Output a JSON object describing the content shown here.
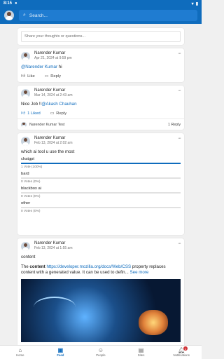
{
  "status": {
    "time": "8:15",
    "icons": [
      "wifi-icon",
      "battery-icon"
    ]
  },
  "header": {
    "search_label": "Search..."
  },
  "compose": {
    "placeholder": "Share your thoughts or questions..."
  },
  "posts": [
    {
      "author": "Narender Kumar",
      "date": "Apr 21, 2024 at 9:59 pm",
      "body_mention": "@Narender Kumar",
      "body_suffix": " hi",
      "like_label": "Like",
      "reply_label": "Reply"
    },
    {
      "author": "Narender Kumar",
      "date": "Mar 14, 2024 at 2:43 am",
      "body_prefix": "Nice Job !!",
      "body_mention": "@Akash Chauhan",
      "like_label": "Liked",
      "like_count": "1",
      "reply_label": "Reply",
      "reply_preview_author": "Narender Kumar",
      "reply_preview_text": "Test",
      "reply_count_label": "1 Reply"
    },
    {
      "author": "Narender Kumar",
      "date": "Feb 13, 2024 at 2:02 am",
      "question": "which ai tool u use the most",
      "poll": [
        {
          "label": "chatgpt",
          "votes": "1 Vote (100%)",
          "fraction": 1.0
        },
        {
          "label": "bard",
          "votes": "0 Votes (0%)",
          "fraction": 0.0
        },
        {
          "label": "blackbox ai",
          "votes": "0 Votes (0%)",
          "fraction": 0.0
        },
        {
          "label": "other",
          "votes": "0 Votes (0%)",
          "fraction": 0.0
        }
      ]
    },
    {
      "author": "Narender Kumar",
      "date": "Feb 13, 2024 at 1:55 am",
      "title": "content",
      "body_prefix": "The ",
      "body_bold": "content",
      "body_link": "https://developer.mozilla.org/docs/Web/CSS",
      "body_suffix": " property replaces content with a generated value. It can be used to defin...",
      "see_more": "See more"
    }
  ],
  "nav": [
    {
      "label": "Home",
      "icon": "home-icon",
      "active": false
    },
    {
      "label": "Feed",
      "icon": "feed-icon",
      "active": true
    },
    {
      "label": "People",
      "icon": "people-icon",
      "active": false
    },
    {
      "label": "Sites",
      "icon": "sites-icon",
      "active": false
    },
    {
      "label": "Notifications",
      "icon": "notifications-icon",
      "active": false,
      "badge": "1"
    }
  ]
}
